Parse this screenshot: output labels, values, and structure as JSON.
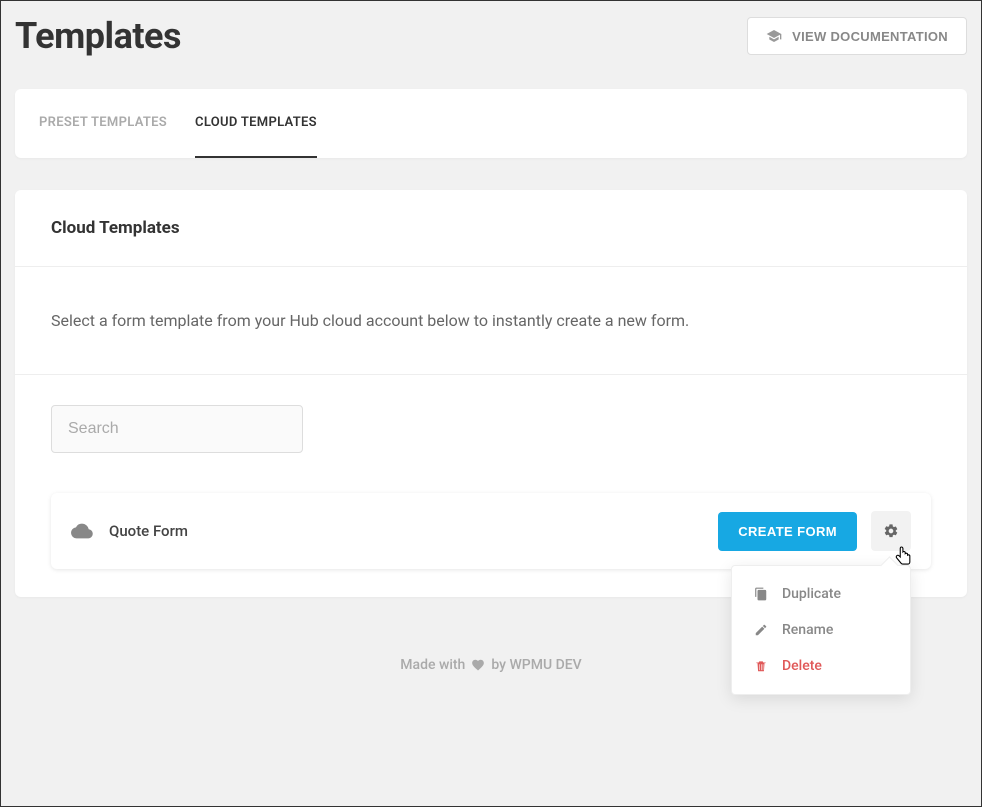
{
  "header": {
    "title": "Templates",
    "doc_button": "VIEW DOCUMENTATION"
  },
  "tabs": {
    "preset": "PRESET TEMPLATES",
    "cloud": "CLOUD TEMPLATES"
  },
  "section": {
    "title": "Cloud Templates",
    "description": "Select a form template from your Hub cloud account below to instantly create a new form."
  },
  "search": {
    "placeholder": "Search"
  },
  "item": {
    "name": "Quote Form",
    "create_button": "CREATE FORM"
  },
  "dropdown": {
    "duplicate": "Duplicate",
    "rename": "Rename",
    "delete": "Delete"
  },
  "footer": {
    "made_with": "Made with",
    "by": "by WPMU DEV"
  }
}
